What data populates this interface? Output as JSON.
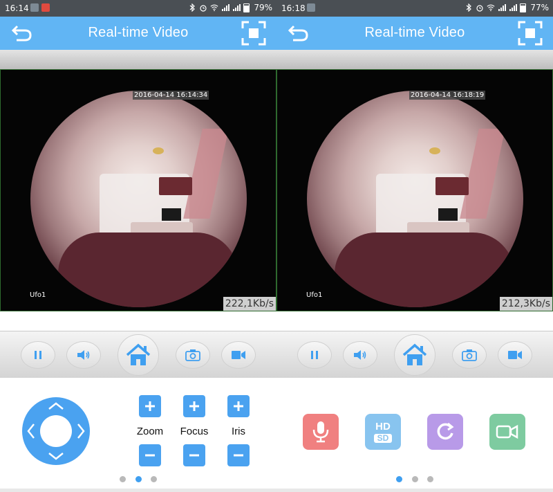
{
  "colors": {
    "appbar": "#61b5f4",
    "statusbar": "#4a4f54",
    "accent": "#4aa2f0",
    "dot_inactive": "#b9b9b9",
    "mic": "#f08080",
    "hdsd": "#88c4ef",
    "refresh": "#b89ae8",
    "record": "#7ecba0"
  },
  "left": {
    "status": {
      "time": "16:14",
      "battery": "79%"
    },
    "appbar": {
      "title": "Real-time Video",
      "back_icon": "back-arrow-icon",
      "fullscreen_icon": "fullscreen-icon"
    },
    "video": {
      "timestamp": "2016-04-14 16:14:34",
      "camera_name": "Ufo1",
      "rate": "222,1Kb/s"
    },
    "controls": [
      "pause-icon",
      "speaker-icon",
      "home-icon",
      "camera-icon",
      "video-icon"
    ],
    "ptz": {
      "zoom_label": "Zoom",
      "focus_label": "Focus",
      "iris_label": "Iris"
    },
    "pager": {
      "count": 3,
      "active": 2
    }
  },
  "right": {
    "status": {
      "time": "16:18",
      "battery": "77%"
    },
    "appbar": {
      "title": "Real-time Video",
      "back_icon": "back-arrow-icon",
      "fullscreen_icon": "fullscreen-icon"
    },
    "video": {
      "timestamp": "2016-04-14 16:18:19",
      "camera_name": "Ufo1",
      "rate": "212,3Kb/s"
    },
    "controls": [
      "pause-icon",
      "speaker-icon",
      "home-icon",
      "camera-icon",
      "video-icon"
    ],
    "actions": {
      "hd_label": "HD",
      "sd_label": "SD"
    },
    "pager": {
      "count": 3,
      "active": 1
    }
  }
}
